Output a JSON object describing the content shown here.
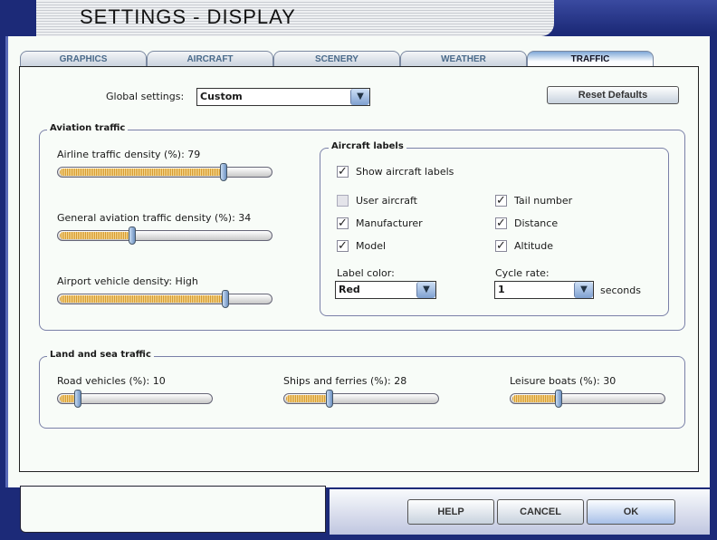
{
  "window": {
    "title": "SETTINGS - DISPLAY"
  },
  "tabs": [
    {
      "label": "GRAPHICS"
    },
    {
      "label": "AIRCRAFT"
    },
    {
      "label": "SCENERY"
    },
    {
      "label": "WEATHER"
    },
    {
      "label": "TRAFFIC",
      "active": true
    }
  ],
  "global": {
    "label": "Global settings:",
    "value": "Custom",
    "reset_label": "Reset Defaults"
  },
  "aviation": {
    "title": "Aviation traffic",
    "sliders": [
      {
        "label": "Airline traffic density (%): 79",
        "value": 79
      },
      {
        "label": "General aviation traffic density (%): 34",
        "value": 34
      },
      {
        "label": "Airport vehicle density: High",
        "value": 80
      }
    ]
  },
  "labels": {
    "title": "Aircraft labels",
    "show": {
      "label": "Show aircraft labels",
      "checked": true
    },
    "items": [
      {
        "label": "User aircraft",
        "checked": false
      },
      {
        "label": "Tail number",
        "checked": true
      },
      {
        "label": "Manufacturer",
        "checked": true
      },
      {
        "label": "Distance",
        "checked": true
      },
      {
        "label": "Model",
        "checked": true
      },
      {
        "label": "Altitude",
        "checked": true
      }
    ],
    "color_label": "Label color:",
    "color_value": "Red",
    "cycle_label": "Cycle rate:",
    "cycle_value": "1",
    "cycle_unit": "seconds"
  },
  "land": {
    "title": "Land and sea traffic",
    "sliders": [
      {
        "label": "Road vehicles (%): 10",
        "value": 10
      },
      {
        "label": "Ships and ferries (%): 28",
        "value": 28
      },
      {
        "label": "Leisure boats (%): 30",
        "value": 30
      }
    ]
  },
  "footer": {
    "help": "HELP",
    "cancel": "CANCEL",
    "ok": "OK"
  },
  "colors": {
    "frame": "#1c2a78",
    "fill": "#d89a30"
  }
}
